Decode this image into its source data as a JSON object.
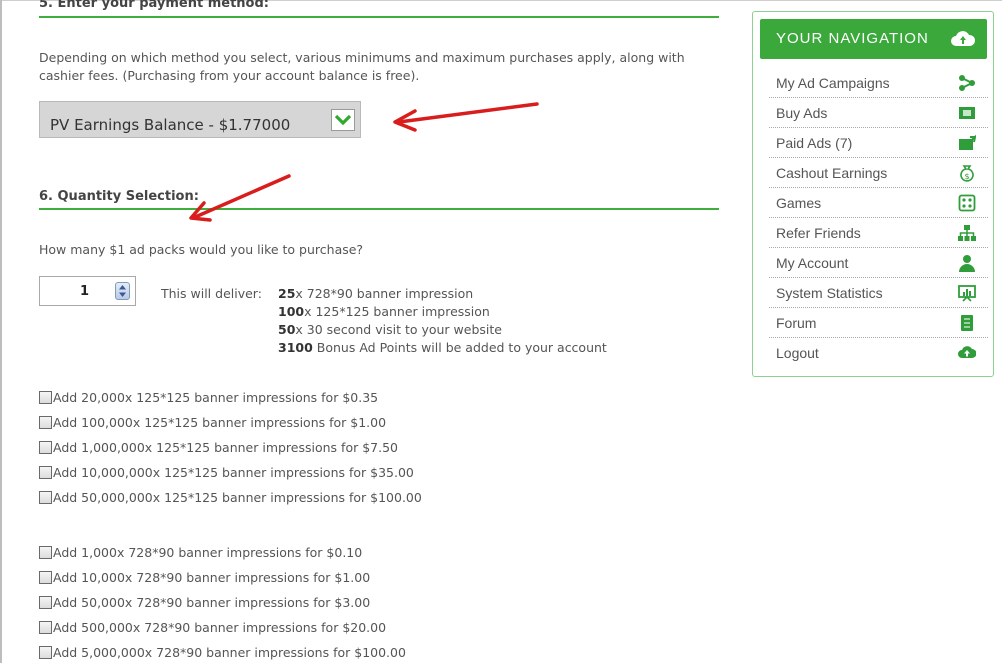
{
  "payment": {
    "title": "5. Enter your payment method:",
    "description": "Depending on which method you select, various minimums and maximum purchases apply, along with cashier fees. (Purchasing from your account balance is free).",
    "selected_method": "PV Earnings Balance - $1.77000"
  },
  "quantity": {
    "title": "6. Quantity Selection:",
    "question": "How many $1 ad packs would you like to purchase?",
    "value": "1",
    "deliver_label": "This will deliver:",
    "deliver": [
      {
        "count": "25",
        "text": "x 728*90 banner impression"
      },
      {
        "count": "100",
        "text": "x 125*125 banner impression"
      },
      {
        "count": "50",
        "text": "x 30 second visit to your website"
      },
      {
        "count": "3100",
        "text": " Bonus Ad Points will be added to your account"
      }
    ]
  },
  "addons_125": [
    "Add 20,000x 125*125 banner impressions for $0.35",
    "Add 100,000x 125*125 banner impressions for $1.00",
    "Add 1,000,000x 125*125 banner impressions for $7.50",
    "Add 10,000,000x 125*125 banner impressions for $35.00",
    "Add 50,000,000x 125*125 banner impressions for $100.00"
  ],
  "addons_728": [
    "Add 1,000x 728*90 banner impressions for $0.10",
    "Add 10,000x 728*90 banner impressions for $1.00",
    "Add 50,000x 728*90 banner impressions for $3.00",
    "Add 500,000x 728*90 banner impressions for $20.00",
    "Add 5,000,000x 728*90 banner impressions for $100.00"
  ],
  "nav": {
    "title": "YOUR NAVIGATION",
    "items": [
      {
        "label": "My Ad Campaigns",
        "icon": "campaigns-icon"
      },
      {
        "label": "Buy Ads",
        "icon": "buy-ads-icon"
      },
      {
        "label": "Paid Ads (7)",
        "icon": "paid-ads-icon"
      },
      {
        "label": "Cashout Earnings",
        "icon": "money-bag-icon"
      },
      {
        "label": "Games",
        "icon": "dice-icon"
      },
      {
        "label": "Refer Friends",
        "icon": "network-icon"
      },
      {
        "label": "My Account",
        "icon": "user-icon"
      },
      {
        "label": "System Statistics",
        "icon": "statistics-icon"
      },
      {
        "label": "Forum",
        "icon": "forum-icon"
      },
      {
        "label": "Logout",
        "icon": "cloud-icon"
      }
    ]
  },
  "colors": {
    "accent_green": "#3aa83a",
    "arrow_red": "#d91c1c"
  }
}
